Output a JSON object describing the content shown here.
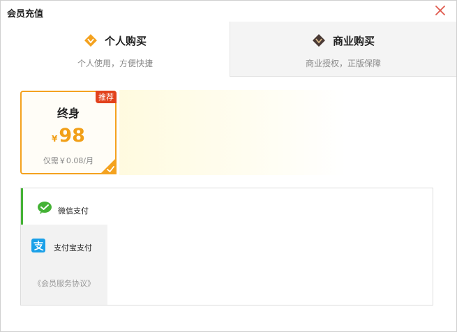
{
  "window": {
    "title": "会员充值"
  },
  "tabs": {
    "personal": {
      "label": "个人购买",
      "subtitle": "个人使用，方便快捷",
      "icon": "gold-diamond-icon",
      "color": "#f4a21f"
    },
    "business": {
      "label": "商业购买",
      "subtitle": "商业授权，正版保障",
      "icon": "dark-diamond-icon",
      "color": "#4a3a35"
    }
  },
  "plan": {
    "badge": "推荐",
    "name": "终身",
    "currency": "¥",
    "price": "98",
    "note": "仅需￥0.08/月",
    "selected": true,
    "accent": "#f4a21f",
    "badge_color": "#e2411c"
  },
  "payment": {
    "methods": [
      {
        "label": "微信支付",
        "icon": "wechat-pay-icon",
        "color": "#44b235",
        "selected": true
      },
      {
        "label": "支付宝支付",
        "icon": "alipay-icon",
        "color": "#1aa0e8",
        "selected": false
      }
    ],
    "agreement": "《会员服务协议》"
  },
  "colors": {
    "close": "#e05a4e"
  }
}
